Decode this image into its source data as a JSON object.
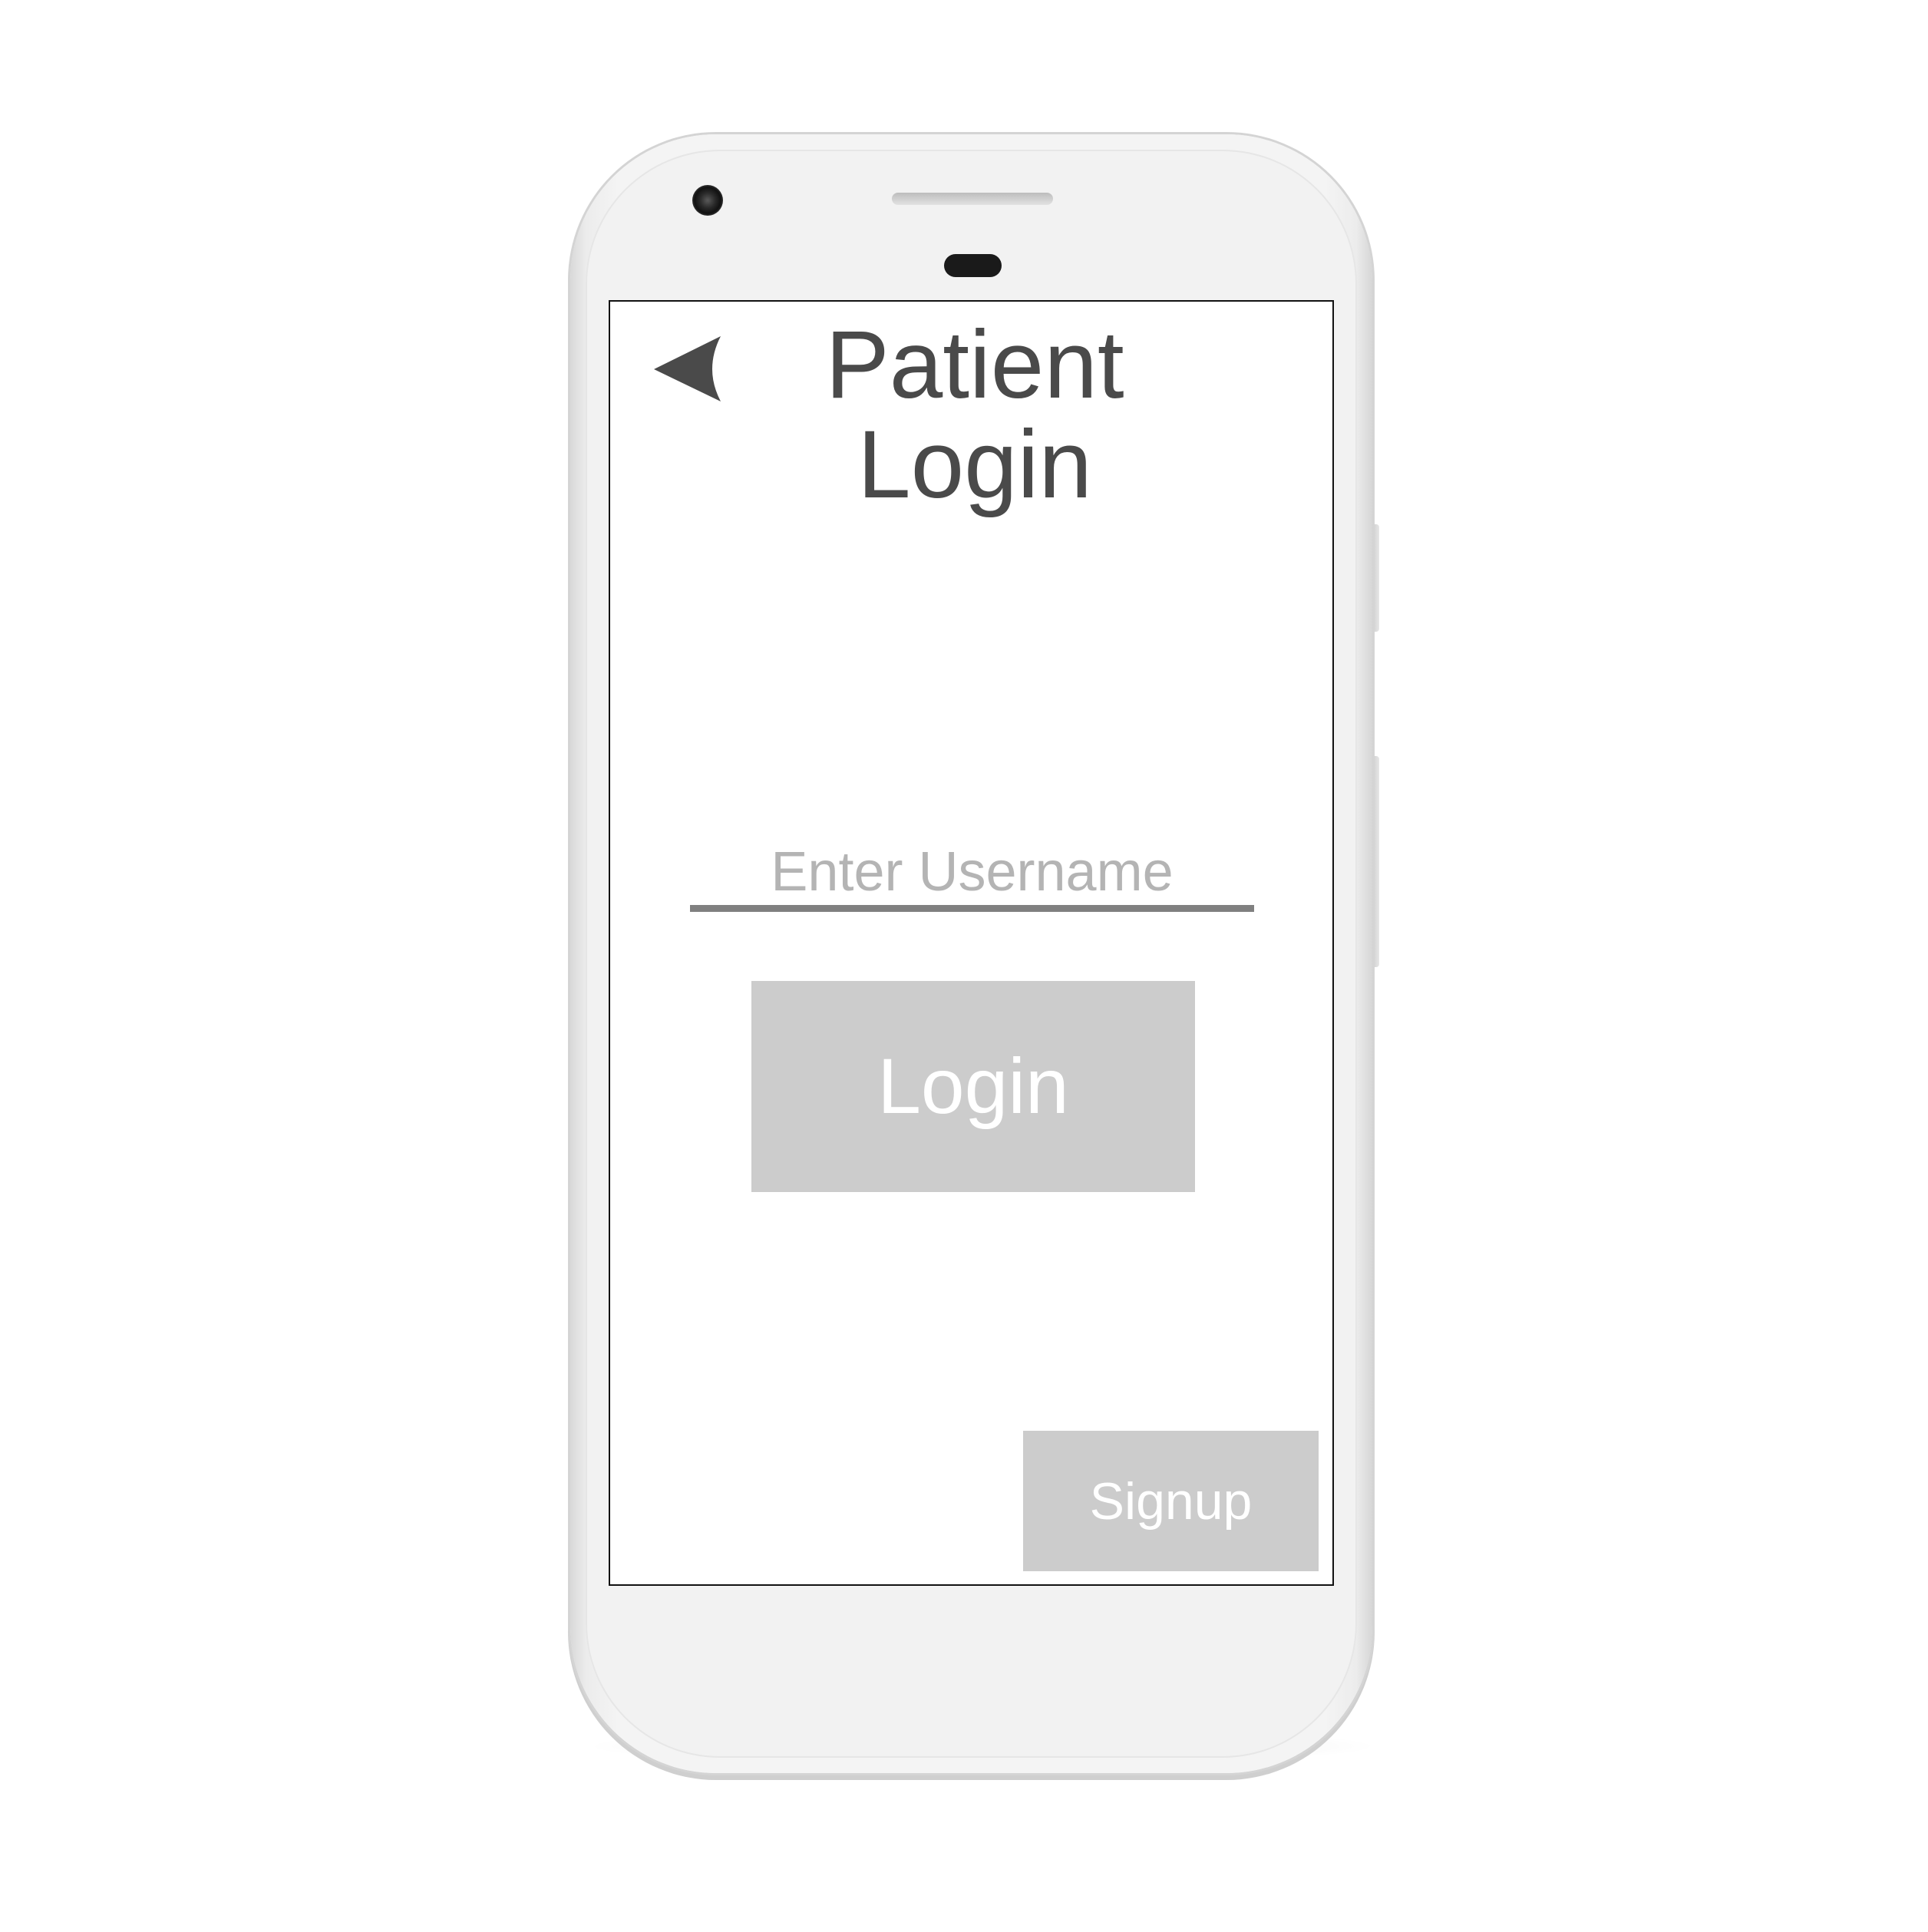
{
  "screen": {
    "title_line1": "Patient",
    "title_line2": "Login",
    "back_icon": "back-arrow-icon",
    "username": {
      "placeholder": "Enter Username",
      "value": ""
    },
    "login_label": "Login",
    "signup_label": "Signup"
  },
  "colors": {
    "title_text": "#4a4a4a",
    "placeholder_text": "#b4b4b4",
    "underline": "#808080",
    "button_bg": "#cccccc",
    "button_text": "#ffffff",
    "phone_body": "#f2f2f2"
  }
}
